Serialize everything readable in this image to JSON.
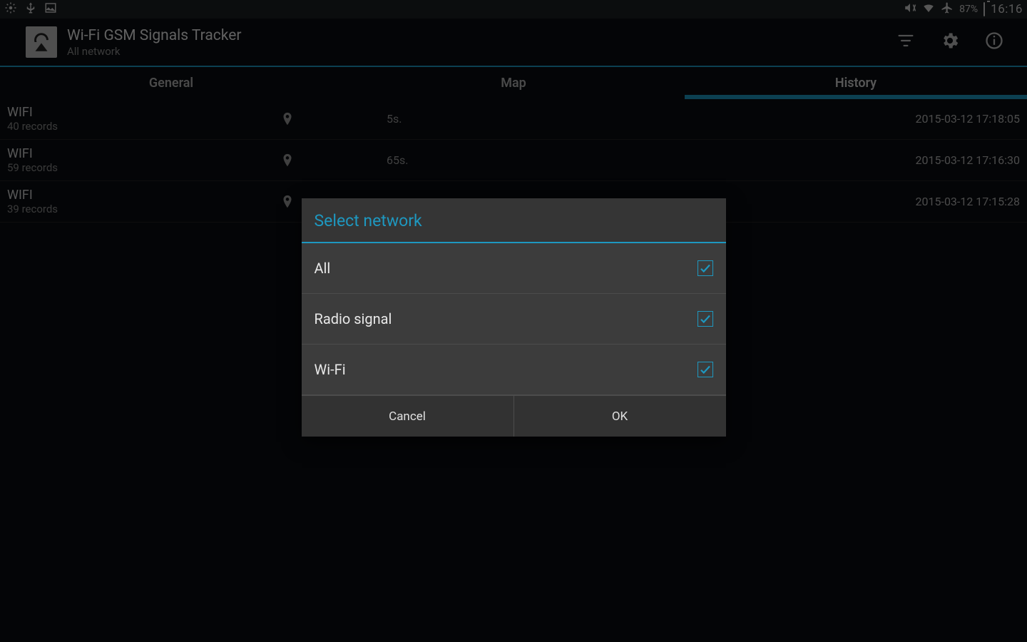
{
  "status": {
    "battery_text": "87%",
    "clock": "16:16"
  },
  "header": {
    "title": "Wi-Fi GSM Signals Tracker",
    "subtitle": "All network"
  },
  "tabs": {
    "general": "General",
    "map": "Map",
    "history": "History",
    "active": "history"
  },
  "rows": [
    {
      "title": "WIFI",
      "records": "40 records",
      "duration": "5s.",
      "timestamp": "2015-03-12 17:18:05"
    },
    {
      "title": "WIFI",
      "records": "59 records",
      "duration": "65s.",
      "timestamp": "2015-03-12 17:16:30"
    },
    {
      "title": "WIFI",
      "records": "39 records",
      "duration": "",
      "timestamp": "2015-03-12 17:15:28"
    }
  ],
  "dialog": {
    "title": "Select network",
    "options": [
      {
        "label": "All",
        "checked": true
      },
      {
        "label": "Radio signal",
        "checked": true
      },
      {
        "label": "Wi-Fi",
        "checked": true
      }
    ],
    "cancel": "Cancel",
    "ok": "OK"
  }
}
